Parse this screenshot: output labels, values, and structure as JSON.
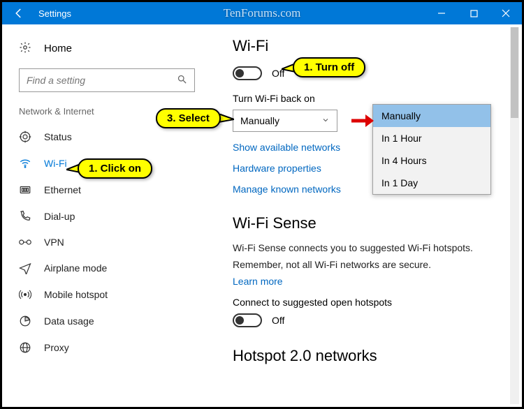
{
  "titlebar": {
    "title": "Settings",
    "watermark": "TenForums.com"
  },
  "sidebar": {
    "home": "Home",
    "search_placeholder": "Find a setting",
    "category": "Network & Internet",
    "items": [
      {
        "label": "Status"
      },
      {
        "label": "Wi-Fi"
      },
      {
        "label": "Ethernet"
      },
      {
        "label": "Dial-up"
      },
      {
        "label": "VPN"
      },
      {
        "label": "Airplane mode"
      },
      {
        "label": "Mobile hotspot"
      },
      {
        "label": "Data usage"
      },
      {
        "label": "Proxy"
      }
    ]
  },
  "content": {
    "h1": "Wi-Fi",
    "wifi_toggle_state": "Off",
    "turn_back_label": "Turn Wi-Fi back on",
    "dropdown_value": "Manually",
    "link1": "Show available networks",
    "link2": "Hardware properties",
    "link3": "Manage known networks",
    "h2a": "Wi-Fi Sense",
    "sense_p1": "Wi-Fi Sense connects you to suggested Wi-Fi hotspots.",
    "sense_p2": "Remember, not all Wi-Fi networks are secure.",
    "learn_more": "Learn more",
    "sense_toggle_label": "Connect to suggested open hotspots",
    "sense_toggle_state": "Off",
    "h2b": "Hotspot 2.0 networks"
  },
  "popup": {
    "options": [
      "Manually",
      "In 1 Hour",
      "In 4 Hours",
      "In 1 Day"
    ]
  },
  "callouts": {
    "turn_off": "1. Turn off",
    "click_on": "1. Click on",
    "select": "3. Select"
  }
}
